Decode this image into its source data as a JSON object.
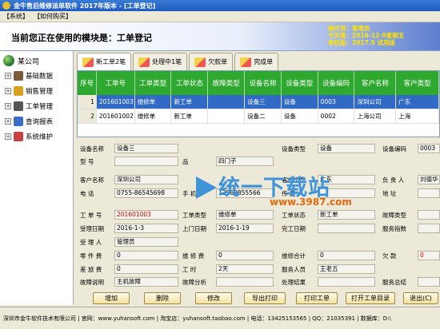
{
  "window": {
    "title": "金牛售后维修派单软件 2017年版本 - [工单登记]"
  },
  "menu": [
    "【系统】",
    "【如何购买】"
  ],
  "header": {
    "module": "当前您正在使用的模块是：工单登记",
    "operator": "操作员：管理员",
    "today": "今天是：2016-12-9星期五",
    "unit": "单机版：2017.5 试用版"
  },
  "tree": {
    "root": "某公司",
    "items": [
      "基础数据",
      "销售管理",
      "工单管理",
      "查询报表",
      "系统维护"
    ]
  },
  "tabs": [
    "新工单2笔",
    "处理中1笔",
    "欠款单",
    "完成单"
  ],
  "grid": {
    "columns": [
      "序号",
      "工单号",
      "工单类型",
      "工单状态",
      "故障类型",
      "设备名称",
      "设备类型",
      "设备编码",
      "客户名称",
      "客户类型"
    ],
    "rows": [
      [
        "1",
        "201601003",
        "维修单",
        "新工单",
        "",
        "设备三",
        "设备",
        "0003",
        "深圳公司",
        "广东"
      ],
      [
        "2",
        "201601002",
        "维修单",
        "新工单",
        "",
        "设备二",
        "设备",
        "0002",
        "上海公司",
        "上海"
      ]
    ]
  },
  "form": {
    "device_name_label": "设备名称",
    "device_name": "设备三",
    "device_type_label": "设备类型",
    "device_type": "设备",
    "device_code_label": "设备编码",
    "device_code": "0003",
    "model_label": "型    号",
    "brand_label": "品",
    "brand_value": "四门子",
    "customer_label": "客户名称",
    "customer": "深圳公司",
    "customer_type_label": "客户类型",
    "customer_type": "广东",
    "person_label": "负 责 人",
    "person": "刘德华",
    "phone_label": "电    话",
    "phone": "0755-86545698",
    "mobile_label": "手    机",
    "mobile": "13569855566",
    "fax_label": "传    真",
    "address_label": "地    址",
    "order_no_label": "工 单 号",
    "order_no": "201601003",
    "order_type_label": "工单类型",
    "order_type": "维修单",
    "order_state_label": "工单状态",
    "order_state": "新工单",
    "fault_type_label": "故障类型",
    "accept_date_label": "受理日期",
    "accept_date": "2016-1-3",
    "visit_date_label": "上门日期",
    "visit_date": "2016-1-19",
    "finish_date_label": "完工日期",
    "service_eval_label": "服务指数",
    "receiver_label": "受 理 人",
    "receiver": "管理员",
    "parts_fee_label": "零 件 费",
    "parts_fee": "0",
    "repair_fee_label": "维 修 费",
    "repair_fee": "0",
    "repair_total_label": "维修合计",
    "repair_total": "0",
    "debt_label": "欠    款",
    "debt": "0",
    "travel_fee_label": "差 旅 费",
    "travel_fee": "0",
    "workday_label": "工    时",
    "workday": "2天",
    "service_staff_label": "服务人员",
    "service_staff": "王老五",
    "fault_desc_label": "故障说明",
    "fault_desc": "主机故障",
    "fault_analysis_label": "故障分析",
    "process_result_label": "处理结果",
    "service_total_label": "服务总结"
  },
  "watermark": {
    "text": "统一下载站",
    "url": "www.3987.com"
  },
  "buttons": [
    "增加",
    "删除",
    "修改",
    "导出打印",
    "打印工单",
    "打开工单目录",
    "退出(C)"
  ],
  "status": "深圳市金牛软件技术有限公司 | 官网：www.yuhansoft.com | 淘宝店：yuhansoft.taobao.com | 电话：13425153565 | QQ：21035391 | 数据库：D:\\"
}
